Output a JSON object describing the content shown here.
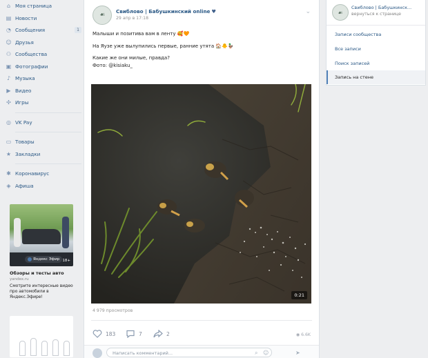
{
  "nav": {
    "items": [
      {
        "label": "Моя страница",
        "icon": "home-icon"
      },
      {
        "label": "Новости",
        "icon": "news-icon"
      },
      {
        "label": "Сообщения",
        "icon": "messages-icon",
        "badge": "1"
      },
      {
        "label": "Друзья",
        "icon": "friends-icon"
      },
      {
        "label": "Сообщества",
        "icon": "groups-icon"
      },
      {
        "label": "Фотографии",
        "icon": "photos-icon"
      },
      {
        "label": "Музыка",
        "icon": "music-icon"
      },
      {
        "label": "Видео",
        "icon": "video-icon"
      },
      {
        "label": "Игры",
        "icon": "games-icon"
      }
    ],
    "items2": [
      {
        "label": "VK Pay",
        "icon": "vkpay-icon"
      }
    ],
    "items3": [
      {
        "label": "Товары",
        "icon": "goods-icon"
      },
      {
        "label": "Закладки",
        "icon": "bookmarks-icon"
      }
    ],
    "items4": [
      {
        "label": "Коронавирус",
        "icon": "virus-icon"
      },
      {
        "label": "Афиша",
        "icon": "poster-icon"
      }
    ]
  },
  "ad": {
    "pill": "Яндекс Эфир",
    "duration": "18+",
    "title": "Обзоры и тесты авто",
    "source": "yandex.ru",
    "desc": "Смотрите интересные видео про автомобили в Яндекс.Эфире!"
  },
  "post": {
    "author": "Свиблово | Бабушкинский online",
    "date": "29 апр в 17:18",
    "text1": "Малыши и позитива вам в ленту 🥰🧡",
    "text2": "На Яузе уже вылупились первые, ранние утята 🏠🐥🦆",
    "text3": "Какие же они милые, правда?",
    "text4": "Фото: @kisiaku_",
    "video_duration": "0:21",
    "views": "4 979 просмотров",
    "likes": "183",
    "comments": "7",
    "shares": "2",
    "seen": "6.6K",
    "comment_placeholder": "Написать комментарий..."
  },
  "right_panel": {
    "title": "Свиблово | Бабушкинск...",
    "back_link": "вернуться к странице",
    "items": [
      {
        "label": "Записи сообщества"
      },
      {
        "label": "Все записи"
      },
      {
        "label": "Поиск записей"
      },
      {
        "label": "Запись на стене",
        "active": true
      }
    ]
  },
  "colors": {
    "link": "#2a5885",
    "accent": "#5181b8",
    "background": "#edeef0"
  }
}
